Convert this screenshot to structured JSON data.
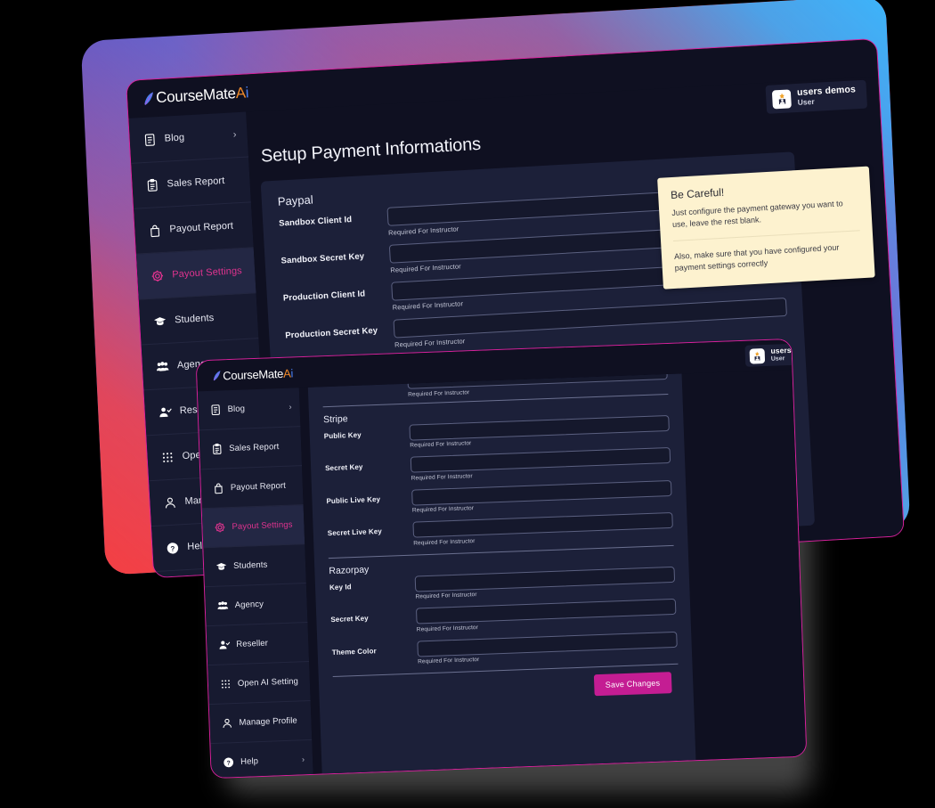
{
  "brand": {
    "name_part1": "CourseMate",
    "name_a": "A",
    "name_i": "i",
    "logo_icon": "rocket-mark-icon"
  },
  "user": {
    "name": "users demos",
    "role": "User",
    "name_clipped": "users",
    "avatar_icon": "user-avatar-icon"
  },
  "sidebar": {
    "items": [
      {
        "label": "Blog",
        "icon": "blog-document-icon",
        "has_chevron": true,
        "active": false
      },
      {
        "label": "Sales Report",
        "icon": "clipboard-icon",
        "has_chevron": false,
        "active": false
      },
      {
        "label": "Payout Report",
        "icon": "bag-icon",
        "has_chevron": false,
        "active": false
      },
      {
        "label": "Payout Settings",
        "icon": "gear-icon",
        "has_chevron": false,
        "active": true
      },
      {
        "label": "Students",
        "icon": "graduation-cap-icon",
        "has_chevron": false,
        "active": false
      },
      {
        "label": "Agency",
        "icon": "people-group-icon",
        "has_chevron": false,
        "active": false
      },
      {
        "label": "Reseller",
        "icon": "user-check-icon",
        "has_chevron": false,
        "active": false
      },
      {
        "label": "Open AI Setting",
        "icon": "grid-dots-icon",
        "has_chevron": false,
        "active": false
      },
      {
        "label": "Manage Profile",
        "icon": "person-icon",
        "has_chevron": false,
        "active": false
      },
      {
        "label": "Help",
        "icon": "question-circle-icon",
        "has_chevron": true,
        "active": false
      }
    ],
    "chevron_glyph": "›"
  },
  "back_window": {
    "page_title": "Setup Payment Informations",
    "section": {
      "title": "Paypal",
      "fields": [
        {
          "label": "Sandbox Client Id",
          "value": "",
          "hint": "Required For Instructor"
        },
        {
          "label": "Sandbox Secret Key",
          "value": "",
          "hint": "Required For Instructor"
        },
        {
          "label": "Production Client Id",
          "value": "",
          "hint": "Required For Instructor"
        },
        {
          "label": "Production Secret Key",
          "value": "",
          "hint": "Required For Instructor"
        }
      ]
    },
    "callout": {
      "title": "Be Careful!",
      "body1": "Just configure the payment gateway you want to use, leave the rest blank.",
      "body2": "Also, make sure that you have configured your payment settings correctly"
    }
  },
  "front_window": {
    "partial_field_hint": "Required For Instructor",
    "sections": [
      {
        "title": "Stripe",
        "fields": [
          {
            "label": "Public Key",
            "value": "",
            "hint": "Required For Instructor"
          },
          {
            "label": "Secret Key",
            "value": "",
            "hint": "Required For Instructor"
          },
          {
            "label": "Public Live Key",
            "value": "",
            "hint": "Required For Instructor"
          },
          {
            "label": "Secret Live Key",
            "value": "",
            "hint": "Required For Instructor"
          }
        ]
      },
      {
        "title": "Razorpay",
        "fields": [
          {
            "label": "Key Id",
            "value": "",
            "hint": "Required For Instructor"
          },
          {
            "label": "Secret Key",
            "value": "",
            "hint": "Required For Instructor"
          },
          {
            "label": "Theme Color",
            "value": "",
            "hint": "Required For Instructor"
          }
        ]
      }
    ],
    "save_label": "Save Changes"
  },
  "colors": {
    "accent_pink": "#d6219b",
    "save_button": "#c41d93",
    "active_nav": "#e0338f",
    "panel_bg": "#1c2039",
    "window_bg": "#0f1021",
    "sidebar_bg": "#171a30",
    "callout_bg": "#fdf2cf",
    "gradient_blue": "#46b8f5",
    "gradient_red": "#f5434a",
    "gradient_purple": "#5b5fd0"
  }
}
